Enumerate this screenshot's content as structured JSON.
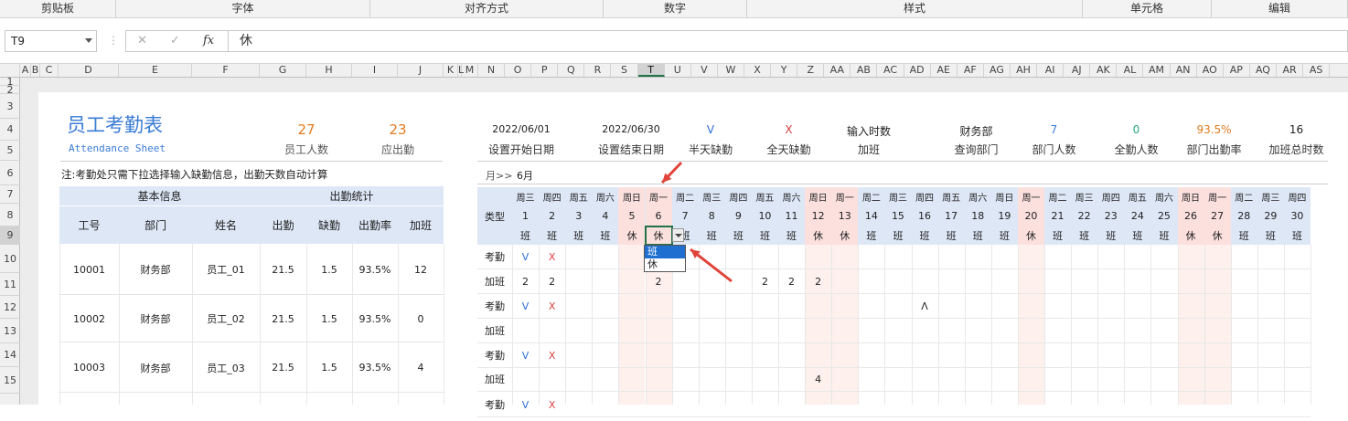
{
  "ribbon": {
    "groups": [
      "剪贴板",
      "字体",
      "对齐方式",
      "数字",
      "样式",
      "单元格",
      "编辑"
    ]
  },
  "formula_bar": {
    "cell_ref": "T9",
    "value": "休",
    "cancel_icon": "✕",
    "enter_icon": "✓",
    "fx_label": "fx"
  },
  "columns": [
    "A",
    "B",
    "C",
    "D",
    "E",
    "F",
    "G",
    "H",
    "I",
    "J",
    "K",
    "L",
    "M",
    "N",
    "O",
    "P",
    "Q",
    "R",
    "S",
    "T",
    "U",
    "V",
    "W",
    "X",
    "Y",
    "Z",
    "AA",
    "AB",
    "AC",
    "AD",
    "AE",
    "AF",
    "AG",
    "AH",
    "AI",
    "AJ",
    "AK",
    "AL",
    "AM",
    "AN",
    "AO",
    "AP",
    "AQ",
    "AR",
    "AS"
  ],
  "selected_column": "T",
  "rows": [
    "1",
    "2",
    "3",
    "4",
    "5",
    "6",
    "7",
    "8",
    "9",
    "10",
    "11",
    "12",
    "13",
    "14",
    "15"
  ],
  "left": {
    "title": "员工考勤表",
    "subtitle": "Attendance Sheet",
    "employees_count": "27",
    "employees_label": "员工人数",
    "required_days": "23",
    "required_label": "应出勤",
    "note": "注:考勤处只需下拉选择输入缺勤信息，出勤天数自动计算",
    "group_basic": "基本信息",
    "group_stats": "出勤统计",
    "headers": [
      "工号",
      "部门",
      "姓名",
      "出勤",
      "缺勤",
      "出勤率",
      "加班"
    ],
    "records": [
      [
        "10001",
        "财务部",
        "员工_01",
        "21.5",
        "1.5",
        "93.5%",
        "12"
      ],
      [
        "10002",
        "财务部",
        "员工_02",
        "21.5",
        "1.5",
        "93.5%",
        "0"
      ],
      [
        "10003",
        "财务部",
        "员工_03",
        "21.5",
        "1.5",
        "93.5%",
        "4"
      ]
    ]
  },
  "right": {
    "stats": [
      {
        "value": "2022/06/01",
        "label": "设置开始日期",
        "color": "#222222"
      },
      {
        "value": "2022/06/30",
        "label": "设置结束日期",
        "color": "#222222"
      },
      {
        "value": "V",
        "label": "半天缺勤",
        "color": "#2f6fd6"
      },
      {
        "value": "X",
        "label": "全天缺勤",
        "color": "#d94040"
      },
      {
        "value": "输入时数",
        "label": "加班",
        "color": "#222222"
      },
      {
        "value": "财务部",
        "label": "查询部门",
        "color": "#222222"
      },
      {
        "value": "7",
        "label": "部门人数",
        "color": "#3a7bd5"
      },
      {
        "value": "0",
        "label": "全勤人数",
        "color": "#2aa876"
      },
      {
        "value": "93.5%",
        "label": "部门出勤率",
        "color": "#e07b22"
      },
      {
        "value": "16",
        "label": "加班总时数",
        "color": "#222222"
      }
    ],
    "month_prefix": "月>>",
    "month": "6月",
    "type_label": "类型",
    "weekdays": [
      "周三",
      "周四",
      "周五",
      "周六",
      "周日",
      "周一",
      "周二",
      "周三",
      "周四",
      "周五",
      "周六",
      "周日",
      "周一",
      "周二",
      "周三",
      "周四",
      "周五",
      "周六",
      "周日",
      "周一",
      "周二",
      "周三",
      "周四",
      "周五",
      "周六",
      "周日",
      "周一",
      "周二",
      "周三",
      "周四"
    ],
    "days": [
      "1",
      "2",
      "3",
      "4",
      "5",
      "6",
      "7",
      "8",
      "9",
      "10",
      "11",
      "12",
      "13",
      "14",
      "15",
      "16",
      "17",
      "18",
      "19",
      "20",
      "21",
      "22",
      "23",
      "24",
      "25",
      "26",
      "27",
      "28",
      "29",
      "30"
    ],
    "types": [
      "班",
      "班",
      "班",
      "班",
      "休",
      "休",
      "班",
      "班",
      "班",
      "班",
      "班",
      "休",
      "休",
      "班",
      "班",
      "班",
      "班",
      "班",
      "班",
      "休",
      "班",
      "班",
      "班",
      "班",
      "班",
      "休",
      "休",
      "班",
      "班",
      "班"
    ],
    "holiday_flags": [
      0,
      0,
      0,
      0,
      1,
      1,
      0,
      0,
      0,
      0,
      0,
      1,
      1,
      0,
      0,
      0,
      0,
      0,
      0,
      1,
      0,
      0,
      0,
      0,
      0,
      1,
      1,
      0,
      0,
      0
    ],
    "row_labels": [
      "考勤",
      "加班",
      "考勤",
      "加班",
      "考勤",
      "加班",
      "考勤"
    ],
    "marks": [
      {
        "row": 0,
        "day": 1,
        "text": "V",
        "color": "#2f6fd6"
      },
      {
        "row": 0,
        "day": 2,
        "text": "X",
        "color": "#d94040"
      },
      {
        "row": 1,
        "day": 1,
        "text": "2",
        "color": "#222222"
      },
      {
        "row": 1,
        "day": 2,
        "text": "2",
        "color": "#222222"
      },
      {
        "row": 1,
        "day": 6,
        "text": "2",
        "color": "#222222"
      },
      {
        "row": 1,
        "day": 10,
        "text": "2",
        "color": "#222222"
      },
      {
        "row": 1,
        "day": 11,
        "text": "2",
        "color": "#222222"
      },
      {
        "row": 1,
        "day": 12,
        "text": "2",
        "color": "#222222"
      },
      {
        "row": 2,
        "day": 1,
        "text": "V",
        "color": "#2f6fd6"
      },
      {
        "row": 2,
        "day": 2,
        "text": "X",
        "color": "#d94040"
      },
      {
        "row": 2,
        "day": 16,
        "text": "Λ",
        "color": "#222222"
      },
      {
        "row": 4,
        "day": 1,
        "text": "V",
        "color": "#2f6fd6"
      },
      {
        "row": 4,
        "day": 2,
        "text": "X",
        "color": "#d94040"
      },
      {
        "row": 5,
        "day": 12,
        "text": "4",
        "color": "#222222"
      },
      {
        "row": 6,
        "day": 1,
        "text": "V",
        "color": "#2f6fd6"
      },
      {
        "row": 6,
        "day": 2,
        "text": "X",
        "color": "#d94040"
      }
    ],
    "dropdown_options": [
      "班",
      "休"
    ],
    "dropdown_selected": "班"
  },
  "colors": {
    "accent": "#3a7bd5",
    "header_fill": "#dde7f6",
    "holiday_fill": "#fbe0de",
    "arrow": "#e0443a"
  }
}
